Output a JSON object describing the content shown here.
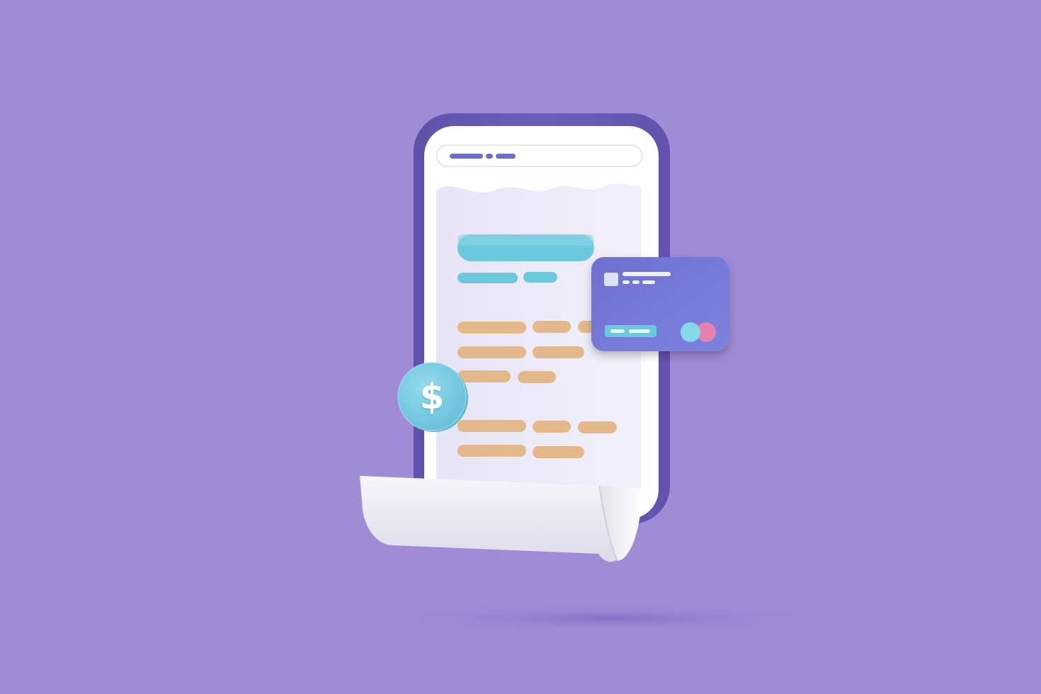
{
  "illustration": {
    "coin_symbol": "$",
    "colors": {
      "background": "#a08bd7",
      "phone_frame": "#6a5db6",
      "screen": "#ffffff",
      "receipt_paper": "#eceaf8",
      "accent_teal": "#6cc9dd",
      "accent_tan": "#e3b98b",
      "card": "#7478d6",
      "coin": "#7dcde3",
      "card_dot_teal": "#86d9e6",
      "card_dot_pink": "#e87fae"
    },
    "icons": [
      "dollar-coin-icon",
      "credit-card-icon",
      "smartphone-icon",
      "receipt-icon"
    ]
  }
}
